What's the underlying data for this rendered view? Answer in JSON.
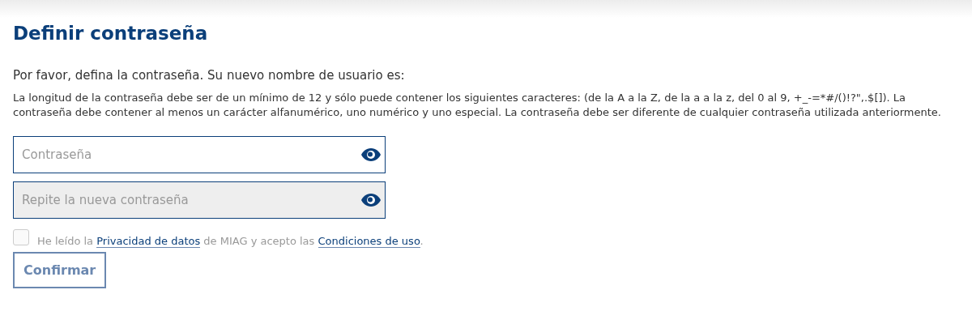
{
  "title": "Definir contraseña",
  "intro": "Por favor, defina la contraseña. Su nuevo nombre de usuario es:",
  "rules": "La longitud de la contraseña debe ser de un mínimo de 12 y sólo puede contener los siguientes caracteres: (de la A a la Z, de la a a la z, del 0 al 9, +_-=*#/()!?\",.$[]). La contraseña debe contener al menos un carácter alfanumérico, uno numérico y uno especial. La contraseña debe ser diferente de cualquier contraseña utilizada anteriormente.",
  "fields": [
    {
      "placeholder": "Contraseña",
      "disabled": false
    },
    {
      "placeholder": "Repite la nueva contraseña",
      "disabled": true
    }
  ],
  "consent": {
    "checked": false,
    "disabled": true,
    "parts": [
      {
        "kind": "text",
        "text": "He leído la "
      },
      {
        "kind": "link",
        "text": "Privacidad de datos"
      },
      {
        "kind": "text",
        "text": " de MIAG y acepto las "
      },
      {
        "kind": "link",
        "text": "Condiciones de uso"
      },
      {
        "kind": "text",
        "text": "."
      }
    ]
  },
  "confirm": {
    "label": "Confirmar",
    "disabled": true
  }
}
